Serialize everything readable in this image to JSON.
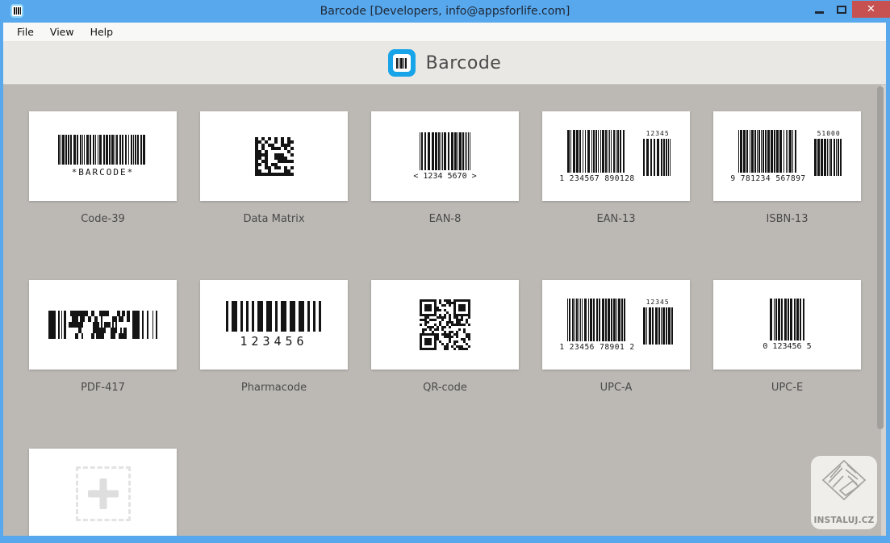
{
  "window": {
    "title": "Barcode [Developers, info@appsforlife.com]",
    "app_icon": "barcode-icon",
    "controls": {
      "minimize": "minimize-icon",
      "maximize": "maximize-icon",
      "close": "close-icon",
      "close_glyph": "✕"
    }
  },
  "menubar": {
    "items": [
      {
        "label": "File"
      },
      {
        "label": "View"
      },
      {
        "label": "Help"
      }
    ]
  },
  "header": {
    "app_name": "Barcode",
    "logo": "barcode-logo"
  },
  "cards": [
    {
      "id": "code-39",
      "label": "Code-39",
      "type": "code39",
      "text": "*BARCODE*"
    },
    {
      "id": "data-matrix",
      "label": "Data Matrix",
      "type": "datamatrix"
    },
    {
      "id": "ean-8",
      "label": "EAN-8",
      "type": "ean8",
      "text": "< 1234 5670 >"
    },
    {
      "id": "ean-13",
      "label": "EAN-13",
      "type": "ean13",
      "text": "1 234567 890128",
      "supplement_text": "12345"
    },
    {
      "id": "isbn-13",
      "label": "ISBN-13",
      "type": "ean13",
      "text": "9 781234 567897",
      "supplement_text": "51000"
    },
    {
      "id": "pdf-417",
      "label": "PDF-417",
      "type": "pdf417"
    },
    {
      "id": "pharmacode",
      "label": "Pharmacode",
      "type": "pharmacode",
      "text": "123456"
    },
    {
      "id": "qr-code",
      "label": "QR-code",
      "type": "qr"
    },
    {
      "id": "upc-a",
      "label": "UPC-A",
      "type": "ean13",
      "text": "1 23456 78901 2",
      "supplement_text": "12345"
    },
    {
      "id": "upc-e",
      "label": "UPC-E",
      "type": "upce",
      "text": "0 123456 5"
    }
  ],
  "add_card": {
    "icon": "plus-icon"
  },
  "watermark": {
    "text": "INSTALUJ.CZ",
    "icon": "instaluj-diamond-logo"
  },
  "scrollbar": {
    "orientation": "vertical"
  },
  "colors": {
    "titlebar_blue": "#58a8ee",
    "close_red": "#c75050",
    "content_bg": "#bcb9b5",
    "header_bg": "#e9e8e4",
    "menubar_bg": "#f8f8f7",
    "card_bg": "#ffffff",
    "label_text": "#4a4a4a",
    "logo_blue": "#18a4e8",
    "bar_ink": "#141414"
  }
}
